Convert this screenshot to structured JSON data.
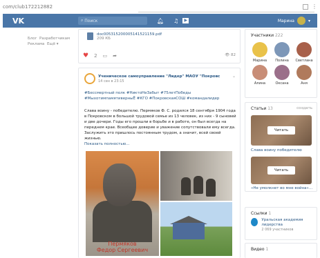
{
  "browser": {
    "url": "com/club172212882"
  },
  "header": {
    "logo": "VK",
    "search_placeholder": "Поиск",
    "user_name": "Марина"
  },
  "left_links": [
    "Блог",
    "Разработчикам",
    "Реклама",
    "Ещё"
  ],
  "post1": {
    "doc_name": "doc005315200005141521159.pdf",
    "doc_size": "209 КБ",
    "likes": "2",
    "views": "82"
  },
  "post2": {
    "group": "Ученическое самоуправление \"Лидер\" МАОУ \"Покровс",
    "date": "14 сен в 23:15",
    "tags": "#Бессмертный полк #НиктоНеЗабыт #75летПобеды #МыхотимпамятиверныЁ #КГО #ПокровскаяСОШ #командалидер",
    "text": "Слава воину - победителю. Пермяков Ф. С. родился 18 сентября 1904 года в Покровском в большой трудовой семье из 13 человек, из них - 9 сыновей и две дочери. Годы его прошли в борьбе и в работе, он был всегда на переднем крае. Всеобщее доверие и уважение сопутствовали ему всегда. Заслужить это пришлось постоянным трудом, а значит, всей своей жизнью.",
    "show_more": "Показать полностью...",
    "photo_caption_line1": "Пермяков",
    "photo_caption_line2": "Федор Сергеевич"
  },
  "members": {
    "title": "Участники",
    "count": "222",
    "list": [
      {
        "name": "Марина",
        "color": "#e9c24a"
      },
      {
        "name": "Полина",
        "color": "#7d97b8"
      },
      {
        "name": "Светлана",
        "color": "#a8604a"
      },
      {
        "name": "Алина",
        "color": "#c88d77"
      },
      {
        "name": "Оксана",
        "color": "#9b6f8a"
      },
      {
        "name": "Аня",
        "color": "#b07a5c"
      }
    ]
  },
  "articles": {
    "title": "Статьи",
    "count": "13",
    "create": "создать",
    "read_label": "Читать",
    "items": [
      {
        "caption": "Слава воину победителю"
      },
      {
        "caption": "«Не умолкнет во мне война»…"
      }
    ]
  },
  "links": {
    "title": "Ссылки",
    "count": "1",
    "item_title": "Уральская академия лидерства",
    "item_sub": "2 069 участников"
  },
  "videos": {
    "title": "Видео",
    "count": "1"
  }
}
